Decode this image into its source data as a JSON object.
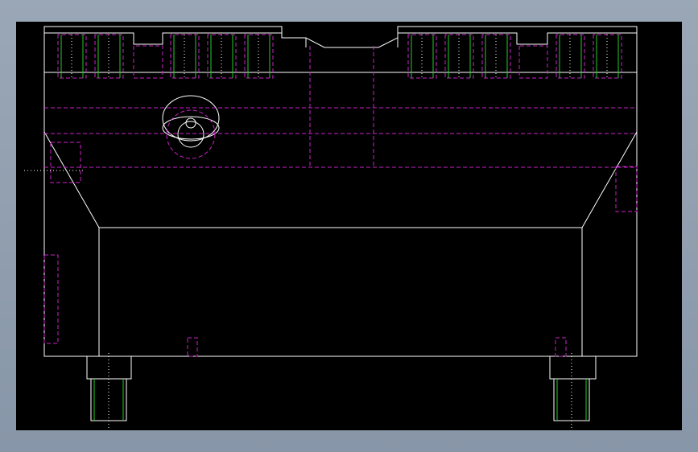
{
  "app": {
    "view": "cad-drawing-viewport"
  },
  "drawing": {
    "background_color": "#000000",
    "outline_color": "#ffffff",
    "hidden_line_color": "#cc22cc",
    "thread_line_color": "#22cc22",
    "window_background": "#8e9cae",
    "upper_bolts": 12,
    "lower_studs": 2,
    "symbols": [
      "centerline",
      "hidden-lines",
      "thread-markers",
      "circular-feature"
    ]
  }
}
